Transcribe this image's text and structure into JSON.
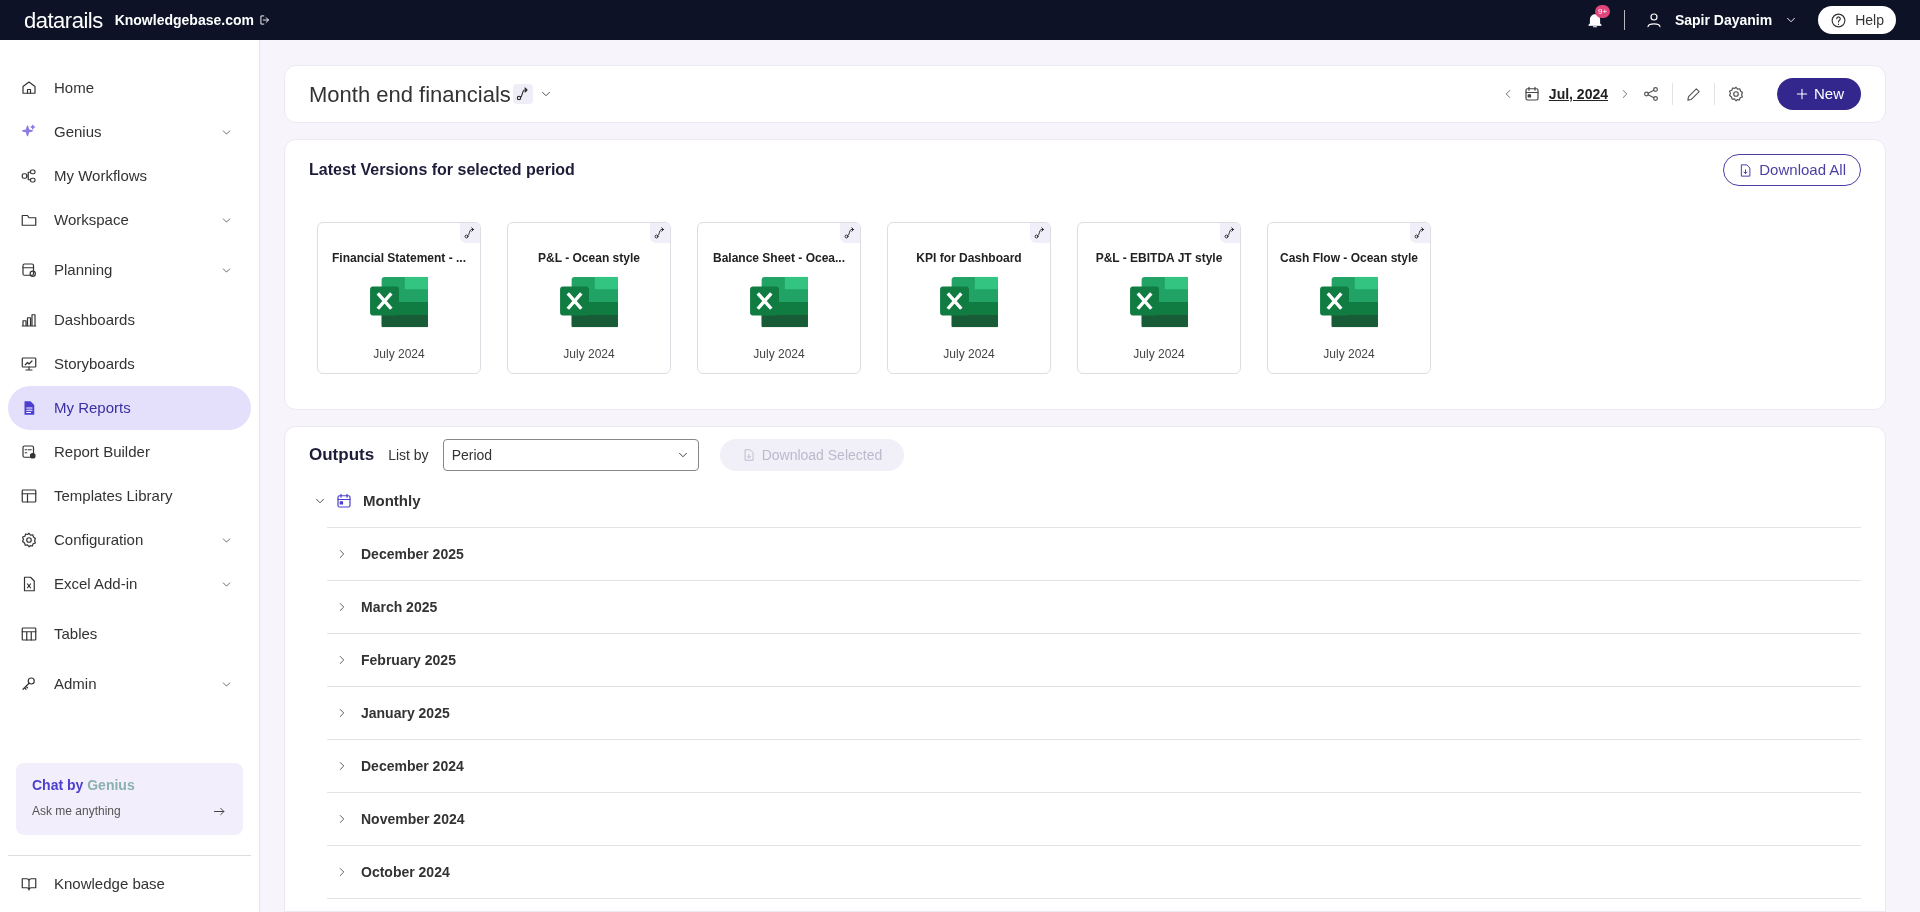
{
  "topbar": {
    "brand": "datarails",
    "workspace": "Knowledgebase.com",
    "notifications": "9+",
    "user": "Sapir Dayanim",
    "help": "Help"
  },
  "sidebar": {
    "items": [
      {
        "label": "Home",
        "kind": "link",
        "expandable": false,
        "selected": false
      },
      {
        "label": "Genius",
        "kind": "genius",
        "expandable": true,
        "selected": false
      },
      {
        "label": "My Workflows",
        "kind": "link",
        "expandable": false,
        "selected": false
      },
      {
        "label": "Workspace",
        "kind": "link",
        "expandable": true,
        "selected": false
      },
      {
        "label": "Planning",
        "kind": "link",
        "expandable": true,
        "selected": false
      },
      {
        "label": "Dashboards",
        "kind": "link",
        "expandable": false,
        "selected": false
      },
      {
        "label": "Storyboards",
        "kind": "link",
        "expandable": false,
        "selected": false
      },
      {
        "label": "My Reports",
        "kind": "link",
        "expandable": false,
        "selected": true
      },
      {
        "label": "Report Builder",
        "kind": "link",
        "expandable": false,
        "selected": false
      },
      {
        "label": "Templates Library",
        "kind": "link",
        "expandable": false,
        "selected": false
      },
      {
        "label": "Configuration",
        "kind": "link",
        "expandable": true,
        "selected": false
      },
      {
        "label": "Excel Add-in",
        "kind": "link",
        "expandable": true,
        "selected": false
      },
      {
        "label": "Tables",
        "kind": "link",
        "expandable": false,
        "selected": false
      },
      {
        "label": "Admin",
        "kind": "link",
        "expandable": true,
        "selected": false
      }
    ],
    "chat": {
      "title": "Chat by",
      "title_accent": "Genius",
      "subtitle": "Ask me anything"
    },
    "footer": "Knowledge base"
  },
  "header": {
    "title": "Month end financials",
    "period": "Jul, 2024",
    "new_button": "New"
  },
  "latest": {
    "title": "Latest Versions for selected period",
    "download_all": "Download All",
    "files": [
      {
        "name": "Financial Statement - ...",
        "period": "July 2024"
      },
      {
        "name": "P&L - Ocean style",
        "period": "July 2024"
      },
      {
        "name": "Balance Sheet - Ocea...",
        "period": "July 2024"
      },
      {
        "name": "KPI for Dashboard",
        "period": "July 2024"
      },
      {
        "name": "P&L - EBITDA JT style",
        "period": "July 2024"
      },
      {
        "name": "Cash Flow - Ocean style",
        "period": "July 2024"
      }
    ]
  },
  "outputs": {
    "title": "Outputs",
    "list_by_label": "List by",
    "list_by_value": "Period",
    "download_selected": {
      "label": "Download Selected",
      "disabled": true
    },
    "groups": [
      {
        "label": "Monthly",
        "expanded": true,
        "children": [
          {
            "label": "December 2025",
            "expanded": false
          },
          {
            "label": "March 2025",
            "expanded": false
          },
          {
            "label": "February 2025",
            "expanded": false
          },
          {
            "label": "January 2025",
            "expanded": false
          },
          {
            "label": "December 2024",
            "expanded": false
          },
          {
            "label": "November 2024",
            "expanded": false
          },
          {
            "label": "October 2024",
            "expanded": false
          }
        ]
      }
    ]
  }
}
